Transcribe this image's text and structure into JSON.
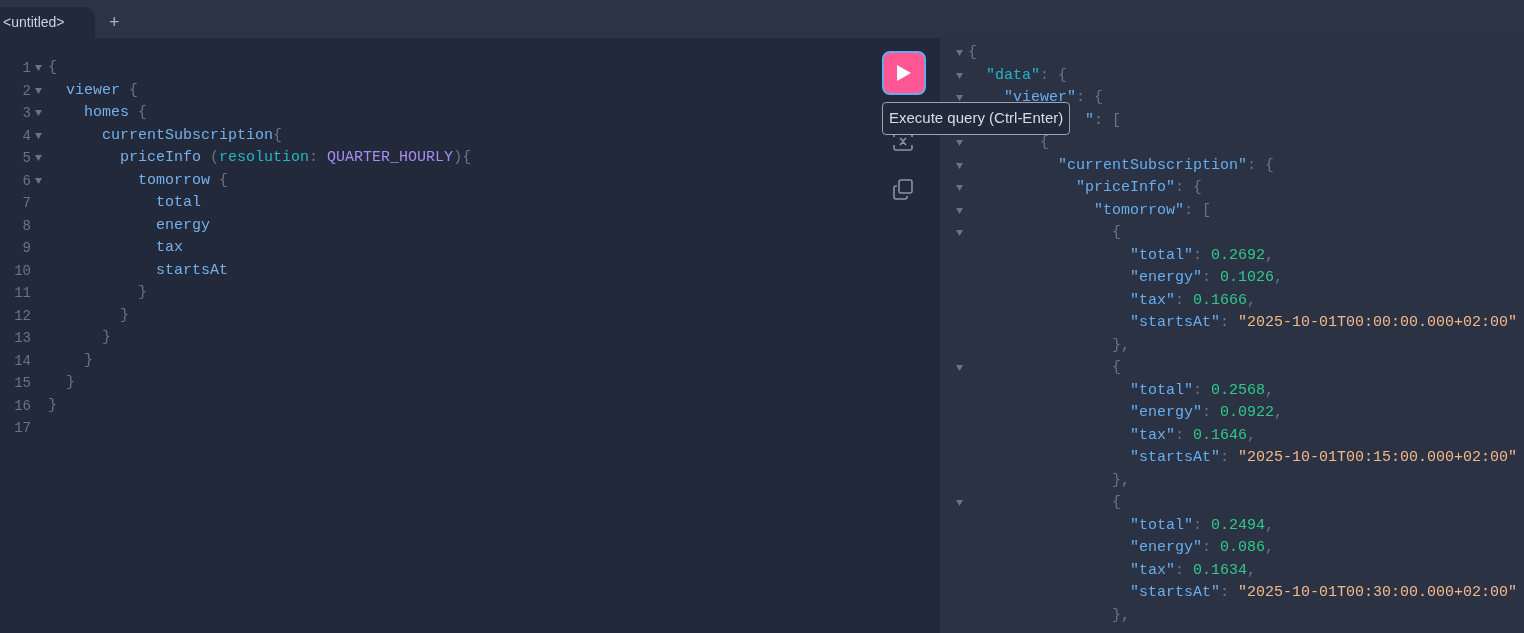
{
  "tabs": [
    {
      "label": "<untitled>",
      "selected": true
    }
  ],
  "new_tab": "+",
  "editor": {
    "lines": [
      {
        "number": "1",
        "fold": true,
        "tokens": [
          {
            "kind": "punct",
            "text": "{"
          }
        ]
      },
      {
        "number": "2",
        "fold": true,
        "tokens": [
          {
            "kind": "field",
            "text": "  viewer"
          },
          {
            "kind": "punct",
            "text": " {"
          }
        ]
      },
      {
        "number": "3",
        "fold": true,
        "tokens": [
          {
            "kind": "field",
            "text": "    homes"
          },
          {
            "kind": "punct",
            "text": " {"
          }
        ]
      },
      {
        "number": "4",
        "fold": true,
        "tokens": [
          {
            "kind": "field",
            "text": "      currentSubscription"
          },
          {
            "kind": "punct",
            "text": "{"
          }
        ]
      },
      {
        "number": "5",
        "fold": true,
        "tokens": [
          {
            "kind": "field",
            "text": "        priceInfo"
          },
          {
            "kind": "punct",
            "text": " ("
          },
          {
            "kind": "arg",
            "text": "resolution"
          },
          {
            "kind": "punct",
            "text": ": "
          },
          {
            "kind": "enum",
            "text": "QUARTER_HOURLY"
          },
          {
            "kind": "punct",
            "text": "){"
          }
        ]
      },
      {
        "number": "6",
        "fold": true,
        "tokens": [
          {
            "kind": "field",
            "text": "          tomorrow"
          },
          {
            "kind": "punct",
            "text": " {"
          }
        ]
      },
      {
        "number": "7",
        "fold": false,
        "tokens": [
          {
            "kind": "field",
            "text": "            total"
          }
        ]
      },
      {
        "number": "8",
        "fold": false,
        "tokens": [
          {
            "kind": "field",
            "text": "            energy"
          }
        ]
      },
      {
        "number": "9",
        "fold": false,
        "tokens": [
          {
            "kind": "field",
            "text": "            tax"
          }
        ]
      },
      {
        "number": "10",
        "fold": false,
        "tokens": [
          {
            "kind": "field",
            "text": "            startsAt"
          }
        ]
      },
      {
        "number": "11",
        "fold": false,
        "tokens": [
          {
            "kind": "punct",
            "text": "          }"
          }
        ]
      },
      {
        "number": "12",
        "fold": false,
        "tokens": [
          {
            "kind": "punct",
            "text": "        }"
          }
        ]
      },
      {
        "number": "13",
        "fold": false,
        "tokens": [
          {
            "kind": "punct",
            "text": "      }"
          }
        ]
      },
      {
        "number": "14",
        "fold": false,
        "tokens": [
          {
            "kind": "punct",
            "text": "    }"
          }
        ]
      },
      {
        "number": "15",
        "fold": false,
        "tokens": [
          {
            "kind": "punct",
            "text": "  }"
          }
        ]
      },
      {
        "number": "16",
        "fold": false,
        "tokens": [
          {
            "kind": "punct",
            "text": "}"
          }
        ]
      },
      {
        "number": "17",
        "fold": false
      }
    ]
  },
  "toolbar": {
    "execute_tooltip": "Execute query (Ctrl-Enter)"
  },
  "result": {
    "lines": [
      {
        "fold": true,
        "tokens": [
          {
            "kind": "punct",
            "text": "{"
          }
        ]
      },
      {
        "fold": true,
        "tokens": [
          {
            "kind": "rootkey",
            "text": "  \"data\""
          },
          {
            "kind": "punct",
            "text": ": {"
          }
        ]
      },
      {
        "fold": true,
        "tokens": [
          {
            "kind": "key",
            "text": "    \"viewer\""
          },
          {
            "kind": "punct",
            "text": ": {"
          }
        ]
      },
      {
        "tokens": [
          {
            "kind": "key",
            "text": "             \""
          },
          {
            "kind": "punct",
            "text": ": ["
          }
        ]
      },
      {
        "fold": true,
        "tokens": [
          {
            "kind": "punct",
            "text": "        {"
          }
        ]
      },
      {
        "fold": true,
        "tokens": [
          {
            "kind": "key",
            "text": "          \"currentSubscription\""
          },
          {
            "kind": "punct",
            "text": ": {"
          }
        ]
      },
      {
        "fold": true,
        "tokens": [
          {
            "kind": "key",
            "text": "            \"priceInfo\""
          },
          {
            "kind": "punct",
            "text": ": {"
          }
        ]
      },
      {
        "fold": true,
        "tokens": [
          {
            "kind": "key",
            "text": "              \"tomorrow\""
          },
          {
            "kind": "punct",
            "text": ": ["
          }
        ]
      },
      {
        "fold": true,
        "tokens": [
          {
            "kind": "punct",
            "text": "                {"
          }
        ]
      },
      {
        "fold": false,
        "tokens": [
          {
            "kind": "key",
            "text": "                  \"total\""
          },
          {
            "kind": "punct",
            "text": ": "
          },
          {
            "kind": "number",
            "text": "0.2692"
          },
          {
            "kind": "punct",
            "text": ","
          }
        ]
      },
      {
        "fold": false,
        "tokens": [
          {
            "kind": "key",
            "text": "                  \"energy\""
          },
          {
            "kind": "punct",
            "text": ": "
          },
          {
            "kind": "number",
            "text": "0.1026"
          },
          {
            "kind": "punct",
            "text": ","
          }
        ]
      },
      {
        "fold": false,
        "tokens": [
          {
            "kind": "key",
            "text": "                  \"tax\""
          },
          {
            "kind": "punct",
            "text": ": "
          },
          {
            "kind": "number",
            "text": "0.1666"
          },
          {
            "kind": "punct",
            "text": ","
          }
        ]
      },
      {
        "fold": false,
        "tokens": [
          {
            "kind": "key",
            "text": "                  \"startsAt\""
          },
          {
            "kind": "punct",
            "text": ": "
          },
          {
            "kind": "string",
            "text": "\"2025-10-01T00:00:00.000+02:00\""
          }
        ]
      },
      {
        "fold": false,
        "tokens": [
          {
            "kind": "punct",
            "text": "                },"
          }
        ]
      },
      {
        "fold": true,
        "tokens": [
          {
            "kind": "punct",
            "text": "                {"
          }
        ]
      },
      {
        "fold": false,
        "tokens": [
          {
            "kind": "key",
            "text": "                  \"total\""
          },
          {
            "kind": "punct",
            "text": ": "
          },
          {
            "kind": "number",
            "text": "0.2568"
          },
          {
            "kind": "punct",
            "text": ","
          }
        ]
      },
      {
        "fold": false,
        "tokens": [
          {
            "kind": "key",
            "text": "                  \"energy\""
          },
          {
            "kind": "punct",
            "text": ": "
          },
          {
            "kind": "number",
            "text": "0.0922"
          },
          {
            "kind": "punct",
            "text": ","
          }
        ]
      },
      {
        "fold": false,
        "tokens": [
          {
            "kind": "key",
            "text": "                  \"tax\""
          },
          {
            "kind": "punct",
            "text": ": "
          },
          {
            "kind": "number",
            "text": "0.1646"
          },
          {
            "kind": "punct",
            "text": ","
          }
        ]
      },
      {
        "fold": false,
        "tokens": [
          {
            "kind": "key",
            "text": "                  \"startsAt\""
          },
          {
            "kind": "punct",
            "text": ": "
          },
          {
            "kind": "string",
            "text": "\"2025-10-01T00:15:00.000+02:00\""
          }
        ]
      },
      {
        "fold": false,
        "tokens": [
          {
            "kind": "punct",
            "text": "                },"
          }
        ]
      },
      {
        "fold": true,
        "tokens": [
          {
            "kind": "punct",
            "text": "                {"
          }
        ]
      },
      {
        "fold": false,
        "tokens": [
          {
            "kind": "key",
            "text": "                  \"total\""
          },
          {
            "kind": "punct",
            "text": ": "
          },
          {
            "kind": "number",
            "text": "0.2494"
          },
          {
            "kind": "punct",
            "text": ","
          }
        ]
      },
      {
        "fold": false,
        "tokens": [
          {
            "kind": "key",
            "text": "                  \"energy\""
          },
          {
            "kind": "punct",
            "text": ": "
          },
          {
            "kind": "number",
            "text": "0.086"
          },
          {
            "kind": "punct",
            "text": ","
          }
        ]
      },
      {
        "fold": false,
        "tokens": [
          {
            "kind": "key",
            "text": "                  \"tax\""
          },
          {
            "kind": "punct",
            "text": ": "
          },
          {
            "kind": "number",
            "text": "0.1634"
          },
          {
            "kind": "punct",
            "text": ","
          }
        ]
      },
      {
        "fold": false,
        "tokens": [
          {
            "kind": "key",
            "text": "                  \"startsAt\""
          },
          {
            "kind": "punct",
            "text": ": "
          },
          {
            "kind": "string",
            "text": "\"2025-10-01T00:30:00.000+02:00\""
          }
        ]
      },
      {
        "fold": false,
        "tokens": [
          {
            "kind": "punct",
            "text": "                },"
          }
        ]
      }
    ]
  }
}
